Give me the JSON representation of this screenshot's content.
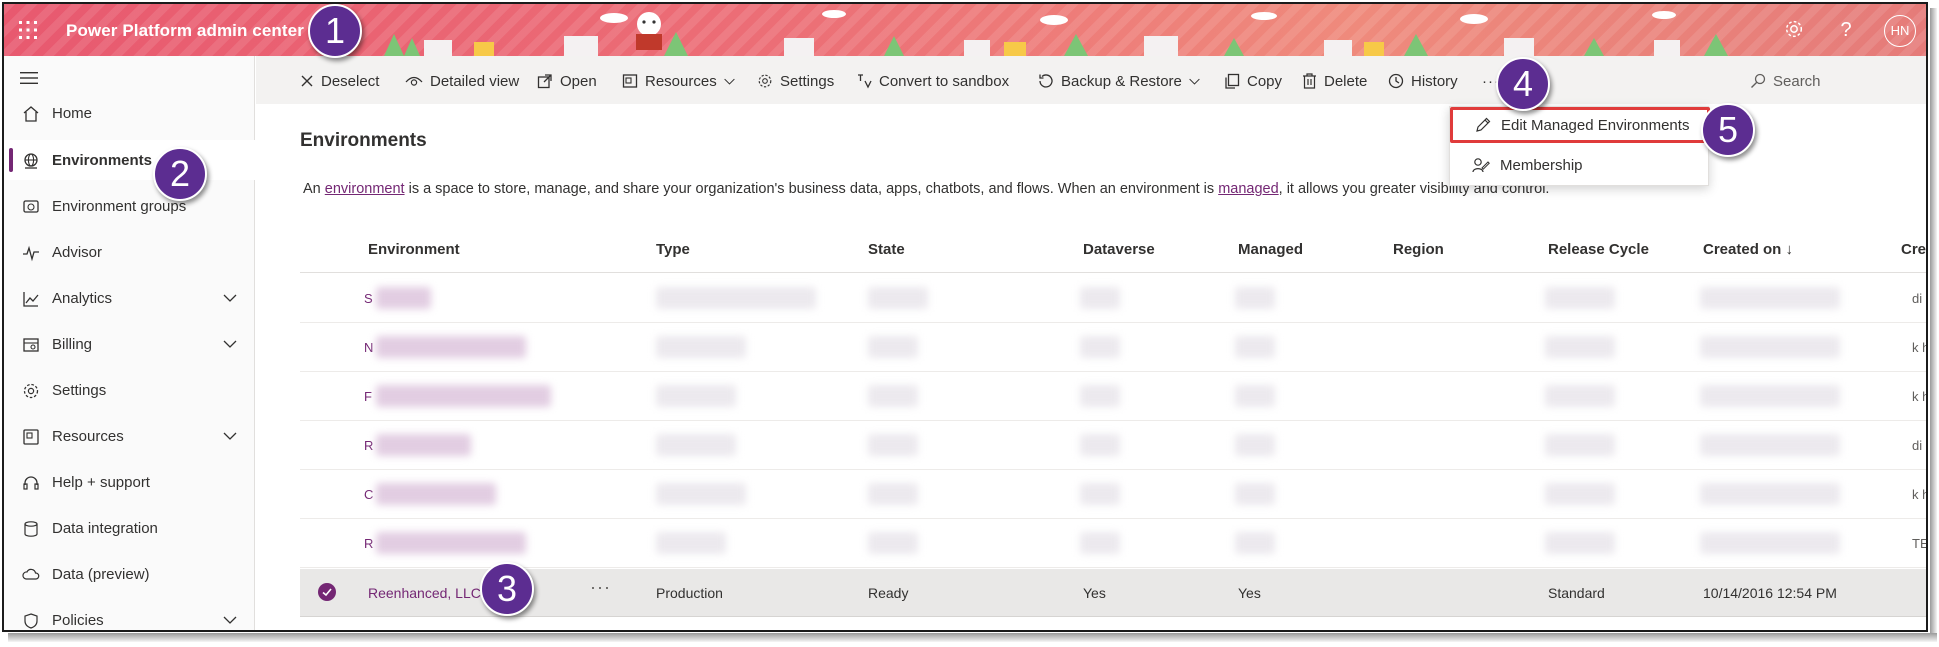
{
  "header": {
    "app_title": "Power Platform admin center",
    "user_initials": "HN",
    "waffle_icon": "waffle-icon",
    "settings_icon": "gear-icon",
    "help_icon": "help-icon",
    "help_glyph": "?"
  },
  "callouts": [
    "1",
    "2",
    "3",
    "4",
    "5"
  ],
  "nav": {
    "items": [
      {
        "label": "Home",
        "icon": "home-icon"
      },
      {
        "label": "Environments",
        "icon": "globe-icon",
        "selected": true
      },
      {
        "label": "Environment groups",
        "icon": "environment-groups-icon"
      },
      {
        "label": "Advisor",
        "icon": "pulse-icon"
      },
      {
        "label": "Analytics",
        "icon": "line-chart-icon",
        "expandable": true
      },
      {
        "label": "Billing",
        "icon": "billing-icon",
        "expandable": true
      },
      {
        "label": "Settings",
        "icon": "gear-icon"
      },
      {
        "label": "Resources",
        "icon": "resources-icon",
        "expandable": true
      },
      {
        "label": "Help + support",
        "icon": "headset-icon"
      },
      {
        "label": "Data integration",
        "icon": "data-integration-icon"
      },
      {
        "label": "Data (preview)",
        "icon": "cloud-data-icon"
      },
      {
        "label": "Policies",
        "icon": "policy-icon",
        "expandable": true
      }
    ]
  },
  "commands": {
    "deselect": "Deselect",
    "detailed_view": "Detailed view",
    "open": "Open",
    "resources": "Resources",
    "settings": "Settings",
    "convert": "Convert to sandbox",
    "backup": "Backup & Restore",
    "copy": "Copy",
    "delete": "Delete",
    "history": "History",
    "more": "···",
    "search": "Search"
  },
  "menu": {
    "items": [
      {
        "label": "Edit Managed Environments",
        "icon": "edit-pencil-icon",
        "highlighted": true
      },
      {
        "label": "Membership",
        "icon": "membership-icon"
      }
    ]
  },
  "page": {
    "title": "Environments",
    "desc_pre": "An ",
    "desc_link1": "environment",
    "desc_mid": " is a space to store, manage, and share your organization's business data, apps, chatbots, and flows. When an environment is ",
    "desc_link2": "managed",
    "desc_post": ", it allows you greater visibility and control."
  },
  "table": {
    "columns": [
      "Environment",
      "Type",
      "State",
      "Dataverse",
      "Managed",
      "Region",
      "Release Cycle",
      "Created on ↓",
      "Creat"
    ],
    "blurred_rows": [
      {
        "first_letter": "S",
        "edge": "di"
      },
      {
        "first_letter": "N",
        "edge": "k h"
      },
      {
        "first_letter": "F",
        "edge": "k h"
      },
      {
        "first_letter": "R",
        "edge": "di"
      },
      {
        "first_letter": "C",
        "edge": "k h"
      },
      {
        "first_letter": "R",
        "edge": "TE"
      }
    ],
    "selected_row": {
      "environment": "Reenhanced, LLC",
      "more": "···",
      "type": "Production",
      "state": "Ready",
      "dataverse": "Yes",
      "managed": "Yes",
      "region": "",
      "release_cycle": "Standard",
      "created_on": "10/14/2016 12:54 PM"
    }
  },
  "colors": {
    "brand": "#742774",
    "callout": "#5c2d91",
    "highlight": "#e03b3b"
  }
}
